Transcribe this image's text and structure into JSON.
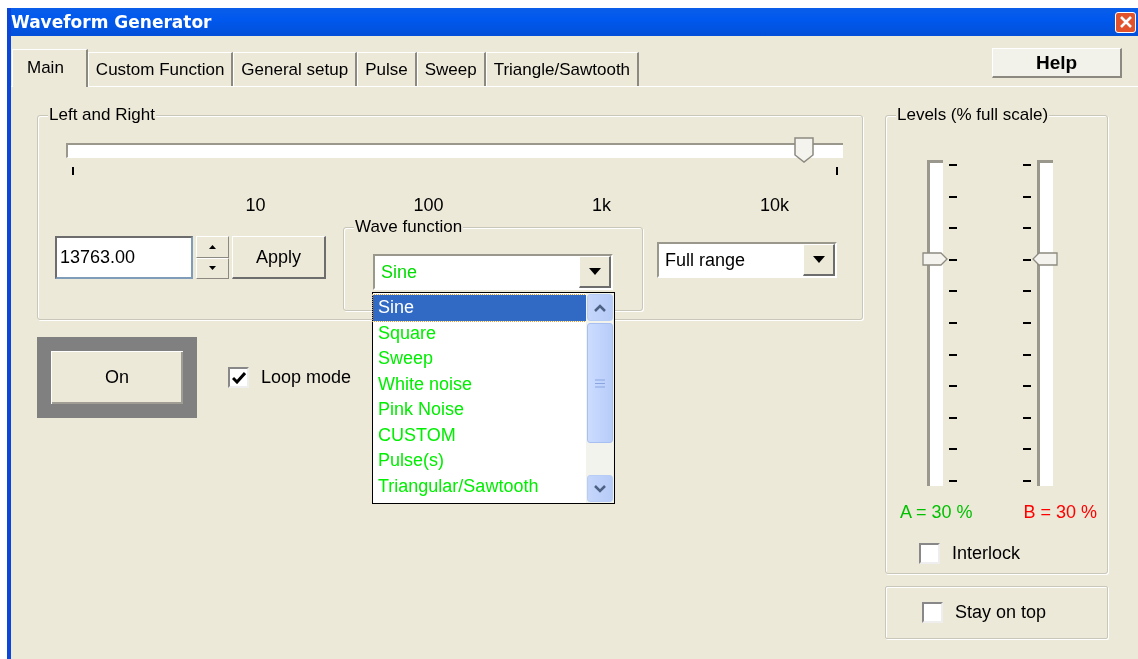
{
  "window": {
    "title": "Waveform Generator"
  },
  "tabs": [
    {
      "label": "Main",
      "selected": true
    },
    {
      "label": "Custom Function",
      "selected": false
    },
    {
      "label": "General setup",
      "selected": false
    },
    {
      "label": "Pulse",
      "selected": false
    },
    {
      "label": "Sweep",
      "selected": false
    },
    {
      "label": "Triangle/Sawtooth",
      "selected": false
    }
  ],
  "help_button": "Help",
  "left_and_right": {
    "title": "Left and  Right",
    "slider": {
      "level": 0.95
    },
    "scale_labels": [
      "10",
      "100",
      "1k",
      "10k"
    ],
    "frequency": {
      "value": "13763.00"
    },
    "apply_button": "Apply"
  },
  "wave_function": {
    "title": "Wave function",
    "value": "Sine",
    "options": [
      {
        "label": "Sine",
        "selected": true
      },
      {
        "label": "Square",
        "selected": false
      },
      {
        "label": "Sweep",
        "selected": false
      },
      {
        "label": "White noise",
        "selected": false
      },
      {
        "label": "Pink Noise",
        "selected": false
      },
      {
        "label": "CUSTOM",
        "selected": false
      },
      {
        "label": "Pulse(s)",
        "selected": false
      },
      {
        "label": "Triangular/Sawtooth",
        "selected": false
      }
    ]
  },
  "range": {
    "value": "Full range"
  },
  "on_button": "On",
  "loop_mode": {
    "label": "Loop mode",
    "checked": true
  },
  "levels": {
    "title": "Levels (% full scale)",
    "channels": [
      {
        "reading": "A = 30 %",
        "color": "#00c000"
      },
      {
        "reading": "B = 30 %",
        "color": "#ff0000"
      }
    ],
    "interlock": {
      "label": "Interlock",
      "checked": false
    }
  },
  "stay_on_top": {
    "label": "Stay on top",
    "checked": false
  }
}
